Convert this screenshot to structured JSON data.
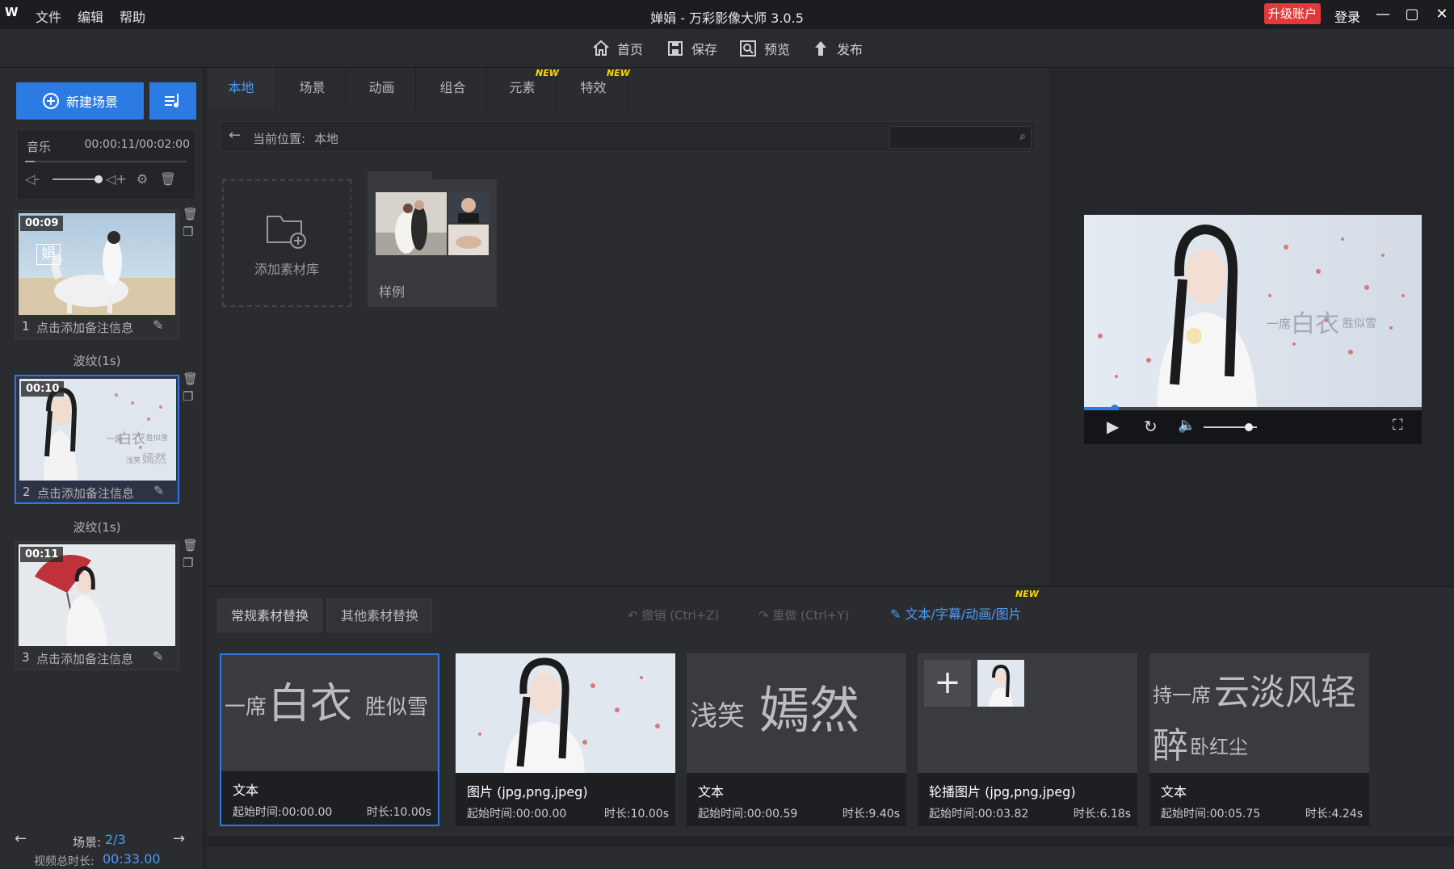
{
  "titlebar": {
    "logo": "W",
    "menus": [
      "文件",
      "编辑",
      "帮助"
    ],
    "title": "婵娟 - 万彩影像大师 3.0.5",
    "upgrade": "升级账户",
    "login": "登录"
  },
  "toolbar": {
    "home": "首页",
    "save": "保存",
    "preview": "预览",
    "publish": "发布"
  },
  "left": {
    "new_scene": "新建场景",
    "music_label": "音乐",
    "music_time": "00:00:11/00:02:00",
    "scenes": [
      {
        "time": "00:09",
        "num": "1",
        "note": "点击添加备注信息"
      },
      {
        "time": "00:10",
        "num": "2",
        "note": "点击添加备注信息"
      },
      {
        "time": "00:11",
        "num": "3",
        "note": "点击添加备注信息"
      }
    ],
    "transitions": [
      "波纹(1s)",
      "波纹(1s)"
    ],
    "scene_label": "场景:",
    "scene_pos": "2/3",
    "total_label": "视频总时长:",
    "total_time": "00:33.00"
  },
  "tabs": [
    {
      "label": "本地",
      "new": ""
    },
    {
      "label": "场景",
      "new": ""
    },
    {
      "label": "动画",
      "new": ""
    },
    {
      "label": "组合",
      "new": ""
    },
    {
      "label": "元素",
      "new": "NEW"
    },
    {
      "label": "特效",
      "new": "NEW"
    }
  ],
  "path": {
    "label": "当前位置:",
    "value": "本地",
    "search_placeholder": ""
  },
  "library": {
    "add_label": "添加素材库",
    "folder_label": "样例"
  },
  "bottom": {
    "tab1": "常规素材替换",
    "tab2": "其他素材替换",
    "undo": "撤销 (Ctrl+Z)",
    "redo": "重做 (Ctrl+Y)",
    "text_link": "文本/字幕/动画/图片",
    "text_link_new": "NEW",
    "assets": [
      {
        "type": "文本",
        "start": "起始时间:00:00.00",
        "duration": "时长:10.00s"
      },
      {
        "type": "图片 (jpg,png,jpeg)",
        "start": "起始时间:00:00.00",
        "duration": "时长:10.00s"
      },
      {
        "type": "文本",
        "start": "起始时间:00:00.59",
        "duration": "时长:9.40s"
      },
      {
        "type": "轮播图片 (jpg,png,jpeg)",
        "start": "起始时间:00:03.82",
        "duration": "时长:6.18s"
      },
      {
        "type": "文本",
        "start": "起始时间:00:05.75",
        "duration": "时长:4.24s"
      }
    ],
    "text1": {
      "a": "一席",
      "b": "白衣",
      "c": "胜似雪"
    },
    "text2": {
      "a": "浅笑",
      "b": "嫣然"
    },
    "text3": {
      "a": "持一席",
      "b": "云淡风轻",
      "c": "醉",
      "d": "卧红尘"
    }
  },
  "preview": {
    "overlay_a": "一席",
    "overlay_b": "白衣",
    "overlay_c": "胜似雪",
    "progress": 0.09,
    "volume": 0.85
  },
  "thumb_text": {
    "s1_char": "娟",
    "s2_a": "一席",
    "s2_b": "白衣",
    "s2_c": "胜似雪",
    "s2_d": "浅笑",
    "s2_e": "嫣然"
  }
}
